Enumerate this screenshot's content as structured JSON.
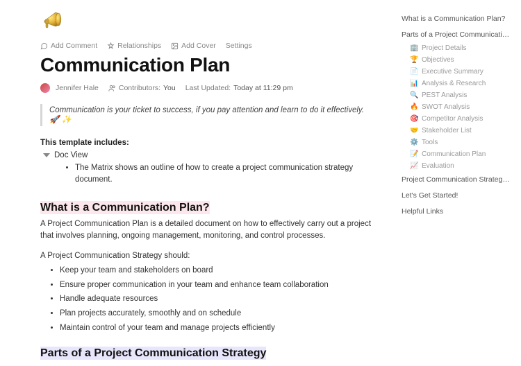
{
  "icon": "📣",
  "toolbar": {
    "comment": "Add Comment",
    "relationships": "Relationships",
    "cover": "Add Cover",
    "settings": "Settings"
  },
  "title": "Communication Plan",
  "author": "Jennifer Hale",
  "contributors_label": "Contributors:",
  "contributors_value": "You",
  "updated_label": "Last Updated:",
  "updated_value": "Today at 11:29 pm",
  "quote": "Communication is your ticket to success, if you pay attention and learn to do it effectively. 🚀 ✨",
  "includes_header": "This template includes:",
  "toggle_label": "Doc View",
  "matrix_bullet": "The Matrix shows an outline of how to create a project communication strategy document.",
  "h2_what": "What is a Communication Plan?",
  "what_para": "A Project Communication Plan is a detailed document on how to effectively carry out a project that involves planning, ongoing management, monitoring, and control processes.",
  "strategy_lead": "A Project Communication Strategy should:",
  "strategy_items": [
    "Keep your team and stakeholders on board",
    "Ensure proper communication in your team and enhance team collaboration",
    "Handle adequate resources",
    "Plan projects accurately, smoothly and on schedule",
    "Maintain control of your team and manage projects efficiently"
  ],
  "h2_parts": "Parts of a Project Communication Strategy",
  "nav": {
    "top": [
      "What is a Communication Plan?",
      "Parts of a Project Communication St…"
    ],
    "subs": [
      {
        "ico": "🏢",
        "label": "Project Details"
      },
      {
        "ico": "🏆",
        "label": "Objectives"
      },
      {
        "ico": "📄",
        "label": "Executive Summary"
      },
      {
        "ico": "📊",
        "label": "Analysis & Research"
      },
      {
        "ico": "🔍",
        "label": "PEST Analysis"
      },
      {
        "ico": "🔥",
        "label": "SWOT Analysis"
      },
      {
        "ico": "🎯",
        "label": "Competitor Analysis"
      },
      {
        "ico": "🤝",
        "label": "Stakeholder List"
      },
      {
        "ico": "⚙️",
        "label": "Tools"
      },
      {
        "ico": "📝",
        "label": "Communication Plan"
      },
      {
        "ico": "📈",
        "label": "Evaluation"
      }
    ],
    "bottom": [
      "Project Communication Strategy Tips!",
      "Let's Get Started!",
      "Helpful Links"
    ]
  }
}
